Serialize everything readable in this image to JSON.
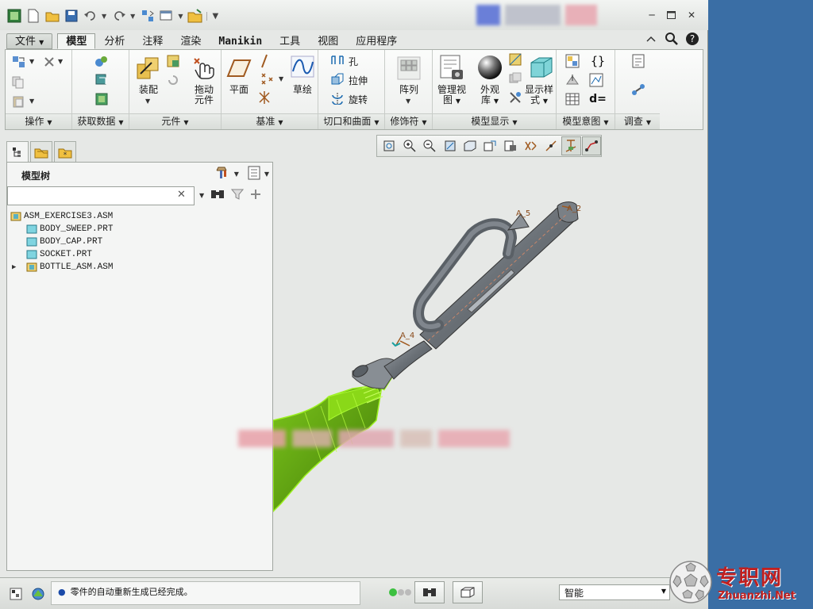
{
  "colors": {
    "desktop": "#3a6ea5",
    "accent_model": "#7fd400",
    "site_red": "#c02020"
  },
  "quick_access": [
    "new-icon",
    "open-icon",
    "save-icon",
    "undo-icon",
    "redo-icon",
    "regenerate-icon",
    "windows-icon",
    "close-window-icon",
    "customize-icon"
  ],
  "tabs": {
    "file": "文件",
    "items": [
      "模型",
      "分析",
      "注释",
      "渲染",
      "Manikin",
      "工具",
      "视图",
      "应用程序"
    ],
    "active": "模型"
  },
  "ribbon": {
    "groups": {
      "operations": "操作",
      "get_data": "获取数据",
      "component": "元件",
      "datum": "基准",
      "cut_surface": "切口和曲面",
      "modifiers": "修饰符",
      "model_display": "模型显示",
      "model_intent": "模型意图",
      "investigate": "调查"
    },
    "buttons": {
      "assemble": "装配",
      "drag_components": [
        "拖动",
        "元件"
      ],
      "plane": "平面",
      "sketch": "草绘",
      "hole": "孔",
      "extrude": "拉伸",
      "revolve": "旋转",
      "pattern": "阵列",
      "manage_views": [
        "管理视",
        "图"
      ],
      "appearance": [
        "外观",
        "库"
      ],
      "display_style": [
        "显示样",
        "式"
      ]
    }
  },
  "navigator": {
    "title": "模型树",
    "search_value": "",
    "tree": [
      {
        "label": "ASM_EXERCISE3.ASM",
        "level": 0,
        "expander": "",
        "kind": "asm"
      },
      {
        "label": "BODY_SWEEP.PRT",
        "level": 1,
        "expander": "",
        "kind": "prt"
      },
      {
        "label": "BODY_CAP.PRT",
        "level": 1,
        "expander": "",
        "kind": "prt"
      },
      {
        "label": "SOCKET.PRT",
        "level": 1,
        "expander": "",
        "kind": "prt"
      },
      {
        "label": "BOTTLE_ASM.ASM",
        "level": 0,
        "expander": "▶",
        "kind": "asm"
      }
    ]
  },
  "viewport": {
    "datum_labels": [
      "A_5",
      "A_2",
      "A_4"
    ]
  },
  "status": {
    "message": "零件的自动重新生成已经完成。",
    "filter": "智能"
  },
  "site": {
    "name": "专职网",
    "url": "Zhuanzhi.Net"
  }
}
